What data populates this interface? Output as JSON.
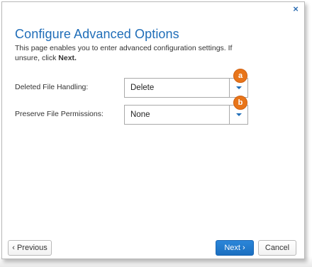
{
  "dialog": {
    "close_glyph": "×",
    "title": "Configure Advanced Options",
    "description_prefix": "This page enables you to enter advanced configuration settings. If unsure, click ",
    "description_bold": "Next.",
    "fields": [
      {
        "label": "Deleted File Handling:",
        "value": "Delete",
        "badge": "a"
      },
      {
        "label": "Preserve File Permissions:",
        "value": "None",
        "badge": "b"
      }
    ],
    "buttons": {
      "previous": "‹ Previous",
      "next": "Next ›",
      "cancel": "Cancel"
    },
    "colors": {
      "accent": "#1f6db8",
      "badge": "#e8751a"
    }
  }
}
